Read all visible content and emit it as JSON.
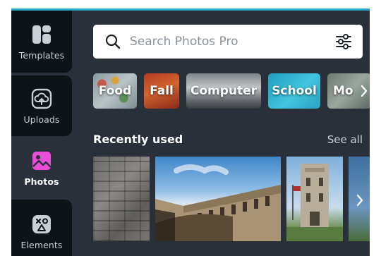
{
  "sidebar": {
    "items": [
      {
        "label": "Templates",
        "icon": "templates-icon",
        "active": false
      },
      {
        "label": "Uploads",
        "icon": "cloud-upload-icon",
        "active": false
      },
      {
        "label": "Photos",
        "icon": "photos-icon",
        "active": true
      },
      {
        "label": "Elements",
        "icon": "elements-icon",
        "active": false
      }
    ]
  },
  "search": {
    "placeholder": "Search Photos Pro",
    "icon": "search-icon",
    "filter_icon": "filter-sliders-icon"
  },
  "categories": [
    {
      "label": "Food"
    },
    {
      "label": "Fall"
    },
    {
      "label": "Computer"
    },
    {
      "label": "School"
    },
    {
      "label": "Mo"
    }
  ],
  "recent": {
    "title": "Recently used",
    "see_all": "See all"
  },
  "colors": {
    "panel": "#293039",
    "sidebar_inactive": "#0e1318",
    "accent_line": "#2fa8c9",
    "photos_icon": "#e84fd6"
  }
}
